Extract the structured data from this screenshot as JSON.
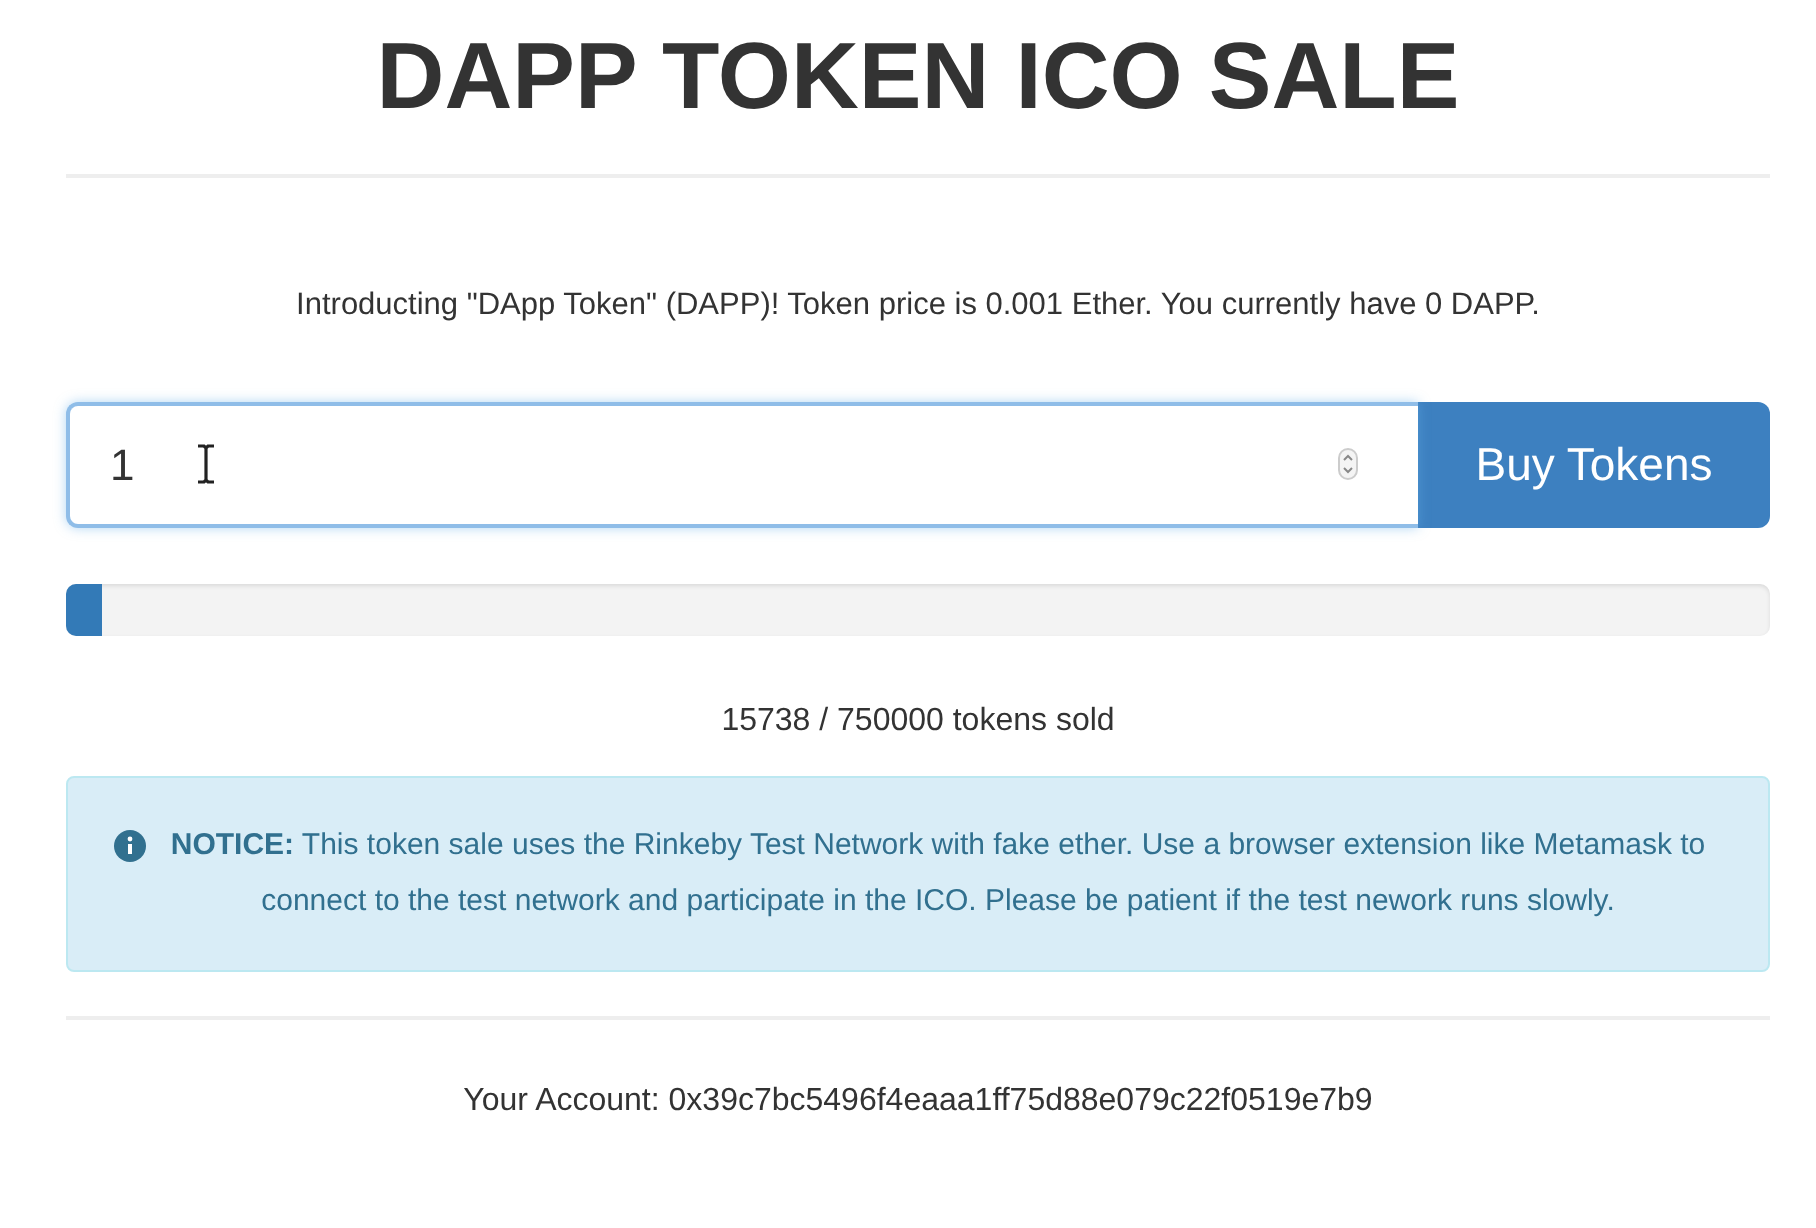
{
  "title": "DAPP TOKEN ICO SALE",
  "intro": "Introducting \"DApp Token\" (DAPP)! Token price is 0.001 Ether. You currently have 0 DAPP.",
  "buy_form": {
    "value": "1",
    "button": "Buy Tokens"
  },
  "progress": {
    "level": 0.021
  },
  "sold": "15738 / 750000 tokens sold",
  "notice": "**NOTICE:** This token sale uses the Rinkeby Test Network with fake ether. Use a browser extension like Metamask to connect to the test network and participate in the ICO. Please be patient if the test nework runs slowly.",
  "account": "Your Account: 0x39c7bc5496f4eaaa1ff75d88e079c22f0519e7b9"
}
